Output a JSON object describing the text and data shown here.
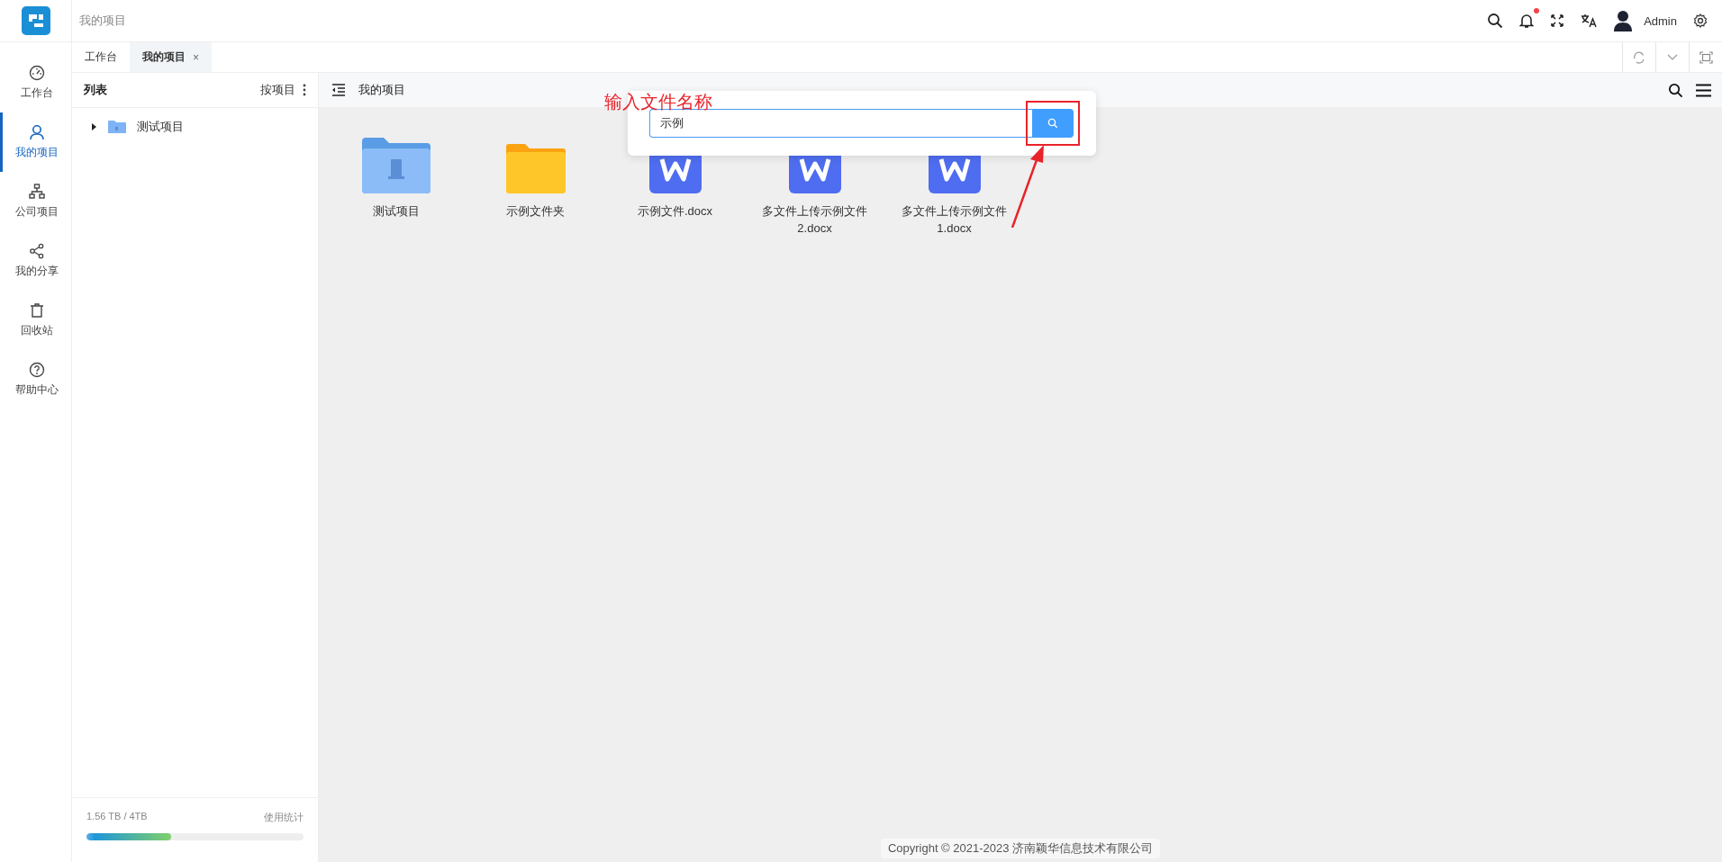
{
  "header": {
    "breadcrumb": "我的项目",
    "user": "Admin",
    "notification_dot": true
  },
  "nav": [
    {
      "label": "工作台",
      "kind": "dashboard",
      "selected": false
    },
    {
      "label": "我的项目",
      "kind": "user",
      "selected": true
    },
    {
      "label": "公司项目",
      "kind": "org",
      "selected": false
    },
    {
      "label": "我的分享",
      "kind": "share",
      "selected": false
    },
    {
      "label": "回收站",
      "kind": "trash",
      "selected": false
    },
    {
      "label": "帮助中心",
      "kind": "help",
      "selected": false
    }
  ],
  "tabs": [
    {
      "label": "工作台",
      "selected": false
    },
    {
      "label": "我的项目",
      "selected": true,
      "close": "×"
    }
  ],
  "list_panel": {
    "title": "列表",
    "sort": "按项目",
    "tree": [
      {
        "label": "测试项目",
        "expanded": false
      }
    ],
    "storage": {
      "usage": "1.56 TB / 4TB",
      "link": "使用统计",
      "level": 0.39
    }
  },
  "toolbar": {
    "title": "我的项目"
  },
  "files": [
    {
      "name": "测试项目",
      "kind": "project"
    },
    {
      "name": "示例文件夹",
      "kind": "folder"
    },
    {
      "name": "示例文件.docx",
      "kind": "word"
    },
    {
      "name": "多文件上传示例文件2.docx",
      "kind": "word"
    },
    {
      "name": "多文件上传示例文件1.docx",
      "kind": "word"
    }
  ],
  "search": {
    "value": "示例"
  },
  "annotation": {
    "text": "输入文件名称"
  },
  "footer": "Copyright © 2021-2023 济南颖华信息技术有限公司"
}
